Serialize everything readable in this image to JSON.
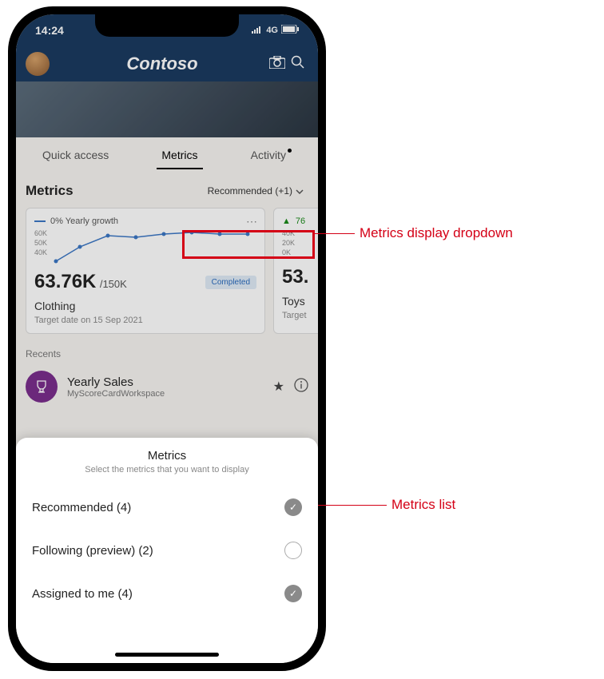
{
  "status": {
    "time": "14:24",
    "network": "4G"
  },
  "header": {
    "brand": "Contoso"
  },
  "tabs": {
    "items": [
      "Quick access",
      "Metrics",
      "Activity"
    ],
    "active_index": 1
  },
  "metrics_section": {
    "title": "Metrics",
    "dropdown_label": "Recommended (+1)"
  },
  "chart_data": {
    "type": "line",
    "title": "0% Yearly growth",
    "yticks": [
      "60K",
      "50K",
      "40K"
    ],
    "ylim": [
      40,
      65
    ],
    "points": [
      42,
      52,
      59,
      58,
      60,
      61,
      60,
      60
    ]
  },
  "card_primary": {
    "legend": "0% Yearly growth",
    "value": "63.76K",
    "denom": "/150K",
    "badge": "Completed",
    "label": "Clothing",
    "sublabel": "Target date on 15 Sep 2021"
  },
  "card_secondary": {
    "trend_value": "76",
    "yticks": [
      "40K",
      "20K",
      "0K"
    ],
    "value": "53.",
    "label": "Toys",
    "sublabel": "Target"
  },
  "recents": {
    "label": "Recents",
    "item": {
      "title": "Yearly Sales",
      "subtitle": "MyScoreCardWorkspace"
    }
  },
  "sheet": {
    "title": "Metrics",
    "subtitle": "Select the metrics that you want to display",
    "options": [
      {
        "label": "Recommended (4)",
        "selected": true
      },
      {
        "label": "Following (preview) (2)",
        "selected": false
      },
      {
        "label": "Assigned to me (4)",
        "selected": true
      }
    ]
  },
  "annotations": {
    "dropdown": "Metrics display dropdown",
    "list": "Metrics list"
  }
}
